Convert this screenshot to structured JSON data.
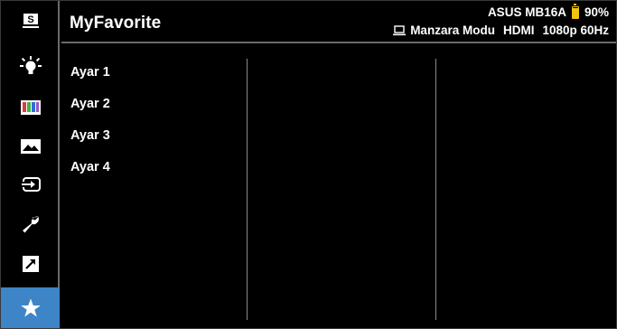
{
  "header": {
    "title": "MyFavorite",
    "model": "ASUS MB16A",
    "battery_percent_label": "90%",
    "battery_level": 0.9,
    "mode": "Manzara Modu",
    "input": "HDMI",
    "resolution": "1080p 60Hz"
  },
  "sidebar": {
    "items": [
      {
        "name": "splendid",
        "icon": "splendid-s-icon"
      },
      {
        "name": "blue-light-filter",
        "icon": "bulb-icon"
      },
      {
        "name": "color",
        "icon": "color-bars-icon"
      },
      {
        "name": "image",
        "icon": "landscape-image-icon"
      },
      {
        "name": "input-select",
        "icon": "input-select-icon"
      },
      {
        "name": "system-setup",
        "icon": "wrench-icon"
      },
      {
        "name": "shortcut",
        "icon": "shortcut-arrow-icon"
      },
      {
        "name": "myfavorite",
        "icon": "star-icon",
        "active": true
      }
    ],
    "splendid_glyph": "S"
  },
  "menu": {
    "items": [
      "Ayar 1",
      "Ayar 2",
      "Ayar 3",
      "Ayar 4"
    ]
  },
  "colors": {
    "background": "#000000",
    "active_highlight": "#3d85c6",
    "battery": "#f1c40f",
    "divider": "#6a6a6a"
  }
}
